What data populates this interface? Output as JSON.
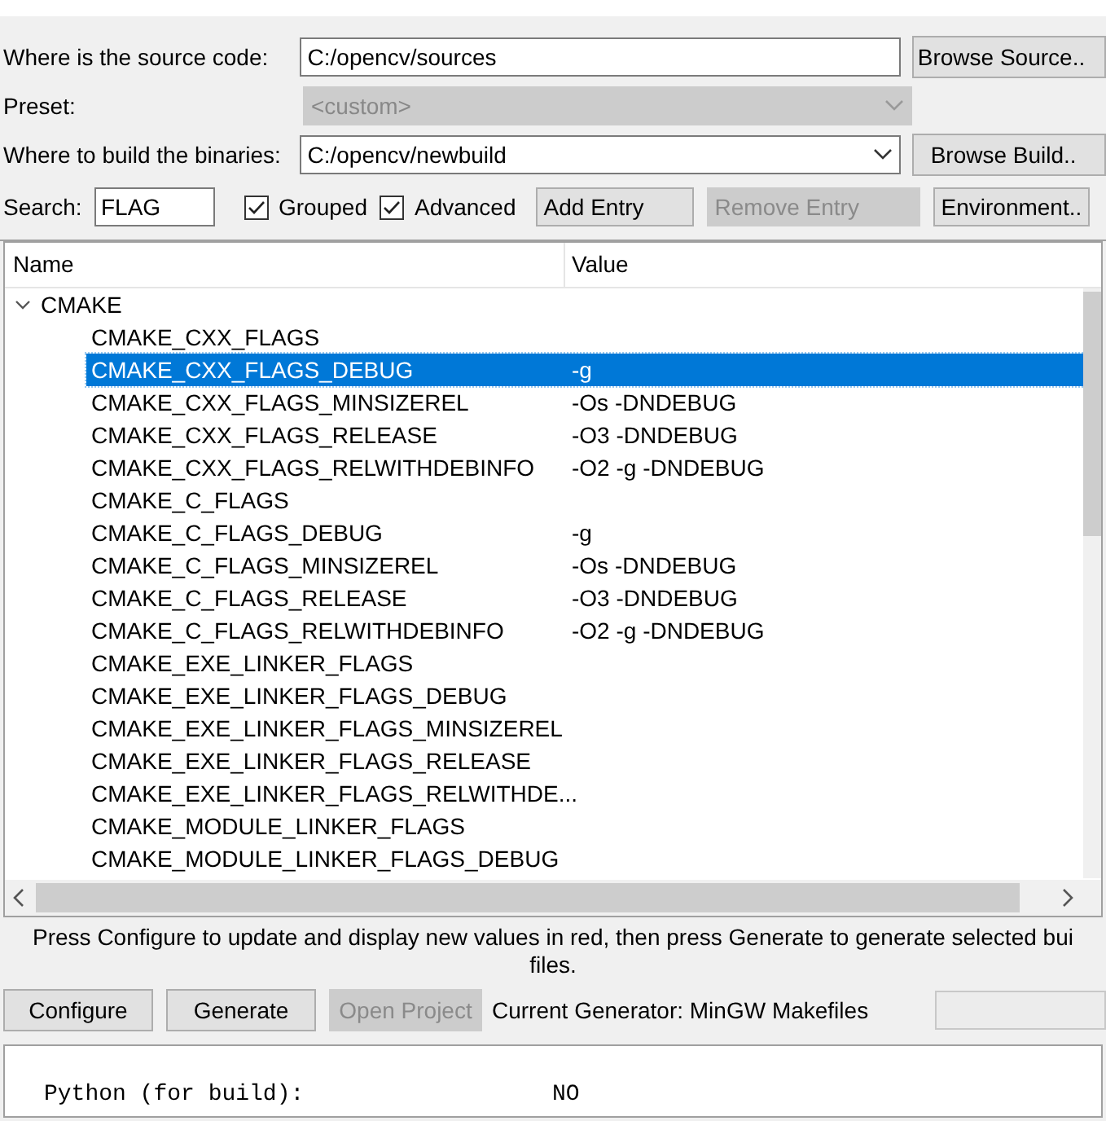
{
  "source": {
    "label": "Where is the source code:",
    "value": "C:/opencv/sources",
    "button": "Browse Source.."
  },
  "preset": {
    "label": "Preset:",
    "value": "<custom>",
    "disabled": true
  },
  "build": {
    "label": "Where to build the binaries:",
    "value": "C:/opencv/newbuild",
    "button": "Browse Build.."
  },
  "search": {
    "label": "Search:",
    "value": "FLAG"
  },
  "options": [
    {
      "label": "Grouped",
      "checked": true
    },
    {
      "label": "Advanced",
      "checked": true
    }
  ],
  "entry_buttons": [
    {
      "label": "Add Entry",
      "disabled": false
    },
    {
      "label": "Remove Entry",
      "disabled": true
    },
    {
      "label": "Environment..",
      "disabled": false
    }
  ],
  "table": {
    "columns": [
      "Name",
      "Value"
    ],
    "groups": [
      {
        "name": "CMAKE",
        "expanded": true,
        "children": [
          {
            "name": "CMAKE_CXX_FLAGS",
            "selected": false
          },
          {
            "name": "CMAKE_CXX_FLAGS_DEBUG",
            "value": "-g",
            "selected": true
          },
          {
            "name": "CMAKE_CXX_FLAGS_MINSIZEREL",
            "value": "-Os -DNDEBUG",
            "selected": false
          },
          {
            "name": "CMAKE_CXX_FLAGS_RELEASE",
            "value": "-O3 -DNDEBUG",
            "selected": false
          },
          {
            "name": "CMAKE_CXX_FLAGS_RELWITHDEBINFO",
            "value": "-O2 -g -DNDEBUG",
            "selected": false
          },
          {
            "name": "CMAKE_C_FLAGS",
            "selected": false
          },
          {
            "name": "CMAKE_C_FLAGS_DEBUG",
            "value": "-g",
            "selected": false
          },
          {
            "name": "CMAKE_C_FLAGS_MINSIZEREL",
            "value": "-Os -DNDEBUG",
            "selected": false
          },
          {
            "name": "CMAKE_C_FLAGS_RELEASE",
            "value": "-O3 -DNDEBUG",
            "selected": false
          },
          {
            "name": "CMAKE_C_FLAGS_RELWITHDEBINFO",
            "value": "-O2 -g -DNDEBUG",
            "selected": false
          },
          {
            "name": "CMAKE_EXE_LINKER_FLAGS",
            "selected": false
          },
          {
            "name": "CMAKE_EXE_LINKER_FLAGS_DEBUG",
            "selected": false
          },
          {
            "name": "CMAKE_EXE_LINKER_FLAGS_MINSIZEREL",
            "selected": false
          },
          {
            "name": "CMAKE_EXE_LINKER_FLAGS_RELEASE",
            "selected": false
          },
          {
            "name": "CMAKE_EXE_LINKER_FLAGS_RELWITHDE...",
            "selected": false
          },
          {
            "name": "CMAKE_MODULE_LINKER_FLAGS",
            "selected": false
          },
          {
            "name": "CMAKE_MODULE_LINKER_FLAGS_DEBUG",
            "selected": false
          }
        ]
      }
    ]
  },
  "hint": "Press Configure to update and display new values in red, then press Generate to generate selected bui files.",
  "actions": [
    {
      "label": "Configure",
      "disabled": false
    },
    {
      "label": "Generate",
      "disabled": false
    },
    {
      "label": "Open Project",
      "disabled": true
    }
  ],
  "generator": "Current Generator: MinGW Makefiles",
  "progress": {
    "level": 0
  },
  "output": [
    {
      "key": "Python (for build):",
      "value": "NO"
    }
  ]
}
